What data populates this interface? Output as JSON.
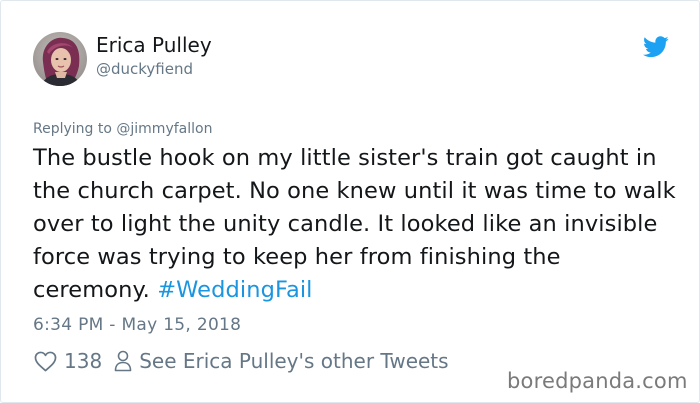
{
  "user": {
    "display_name": "Erica Pulley",
    "handle": "@duckyfiend"
  },
  "reply": {
    "prefix": "Replying to ",
    "mention": "@jimmyfallon"
  },
  "tweet": {
    "text": "The bustle hook on my little sister's train got caught in the church carpet. No one knew until it was time to walk over to light the unity candle. It looked like an invisible force was trying to keep her from finishing the ceremony.",
    "hashtag": "#WeddingFail",
    "timestamp": "6:34 PM - May 15, 2018"
  },
  "actions": {
    "like_icon": "heart-icon",
    "like_count": "138",
    "person_icon": "person-icon",
    "other_tweets_label": "See Erica Pulley's other Tweets"
  },
  "branding": {
    "logo_icon": "twitter-bird-icon",
    "watermark": "boredpanda.com"
  },
  "colors": {
    "link": "#1b95e0",
    "twitter_blue": "#1da1f2",
    "secondary_text": "#657786",
    "primary_text": "#14171a",
    "border": "#e1e8ed"
  }
}
